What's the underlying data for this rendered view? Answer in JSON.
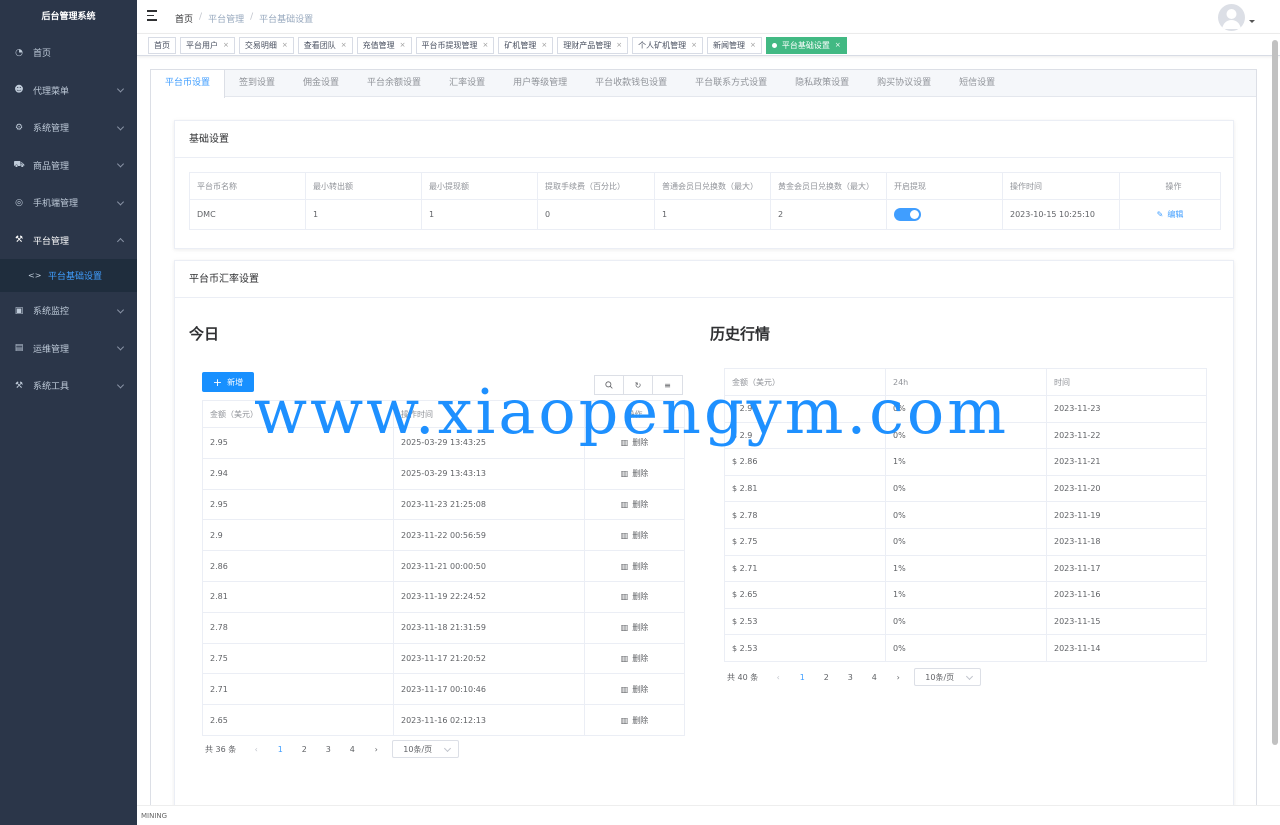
{
  "brand": "后台管理系统",
  "sidebar": {
    "items": [
      {
        "label": "首页",
        "icon": "dashboard-icon",
        "chevron": false
      },
      {
        "label": "代理菜单",
        "icon": "user-icon",
        "chevron": true
      },
      {
        "label": "系统管理",
        "icon": "gear-icon",
        "chevron": true
      },
      {
        "label": "商品管理",
        "icon": "cart-icon",
        "chevron": true
      },
      {
        "label": "手机端管理",
        "icon": "phone-icon",
        "chevron": true
      },
      {
        "label": "平台管理",
        "icon": "tools-icon",
        "chevron": true,
        "open": true
      },
      {
        "label": "系统监控",
        "icon": "monitor-icon",
        "chevron": true
      },
      {
        "label": "运维管理",
        "icon": "server-icon",
        "chevron": true
      },
      {
        "label": "系统工具",
        "icon": "wrench-icon",
        "chevron": true
      }
    ],
    "submenu_active": "平台基础设置"
  },
  "breadcrumb": [
    "首页",
    "平台管理",
    "平台基础设置"
  ],
  "tags": [
    "首页",
    "平台用户",
    "交易明细",
    "查看团队",
    "充值管理",
    "平台币提现管理",
    "矿机管理",
    "理财产品管理",
    "个人矿机管理",
    "新闻管理",
    "平台基础设置"
  ],
  "tabs": [
    "平台币设置",
    "签到设置",
    "佣金设置",
    "平台余额设置",
    "汇率设置",
    "用户等级管理",
    "平台收款钱包设置",
    "平台联系方式设置",
    "隐私政策设置",
    "购买协议设置",
    "短信设置"
  ],
  "basic": {
    "title": "基础设置",
    "headers": [
      "平台币名称",
      "最小转出额",
      "最小提现额",
      "提取手续费（百分比）",
      "普通会员日兑换数（最大）",
      "黄金会员日兑换数（最大）",
      "开启提现",
      "操作时间",
      "操作"
    ],
    "row": [
      "DMC",
      "1",
      "1",
      "0",
      "1",
      "2",
      "",
      "2023-10-15 10:25:10"
    ],
    "edit_label": "编辑",
    "withdraw_enabled": true
  },
  "rate": {
    "title": "平台币汇率设置",
    "today_title": "今日",
    "history_title": "历史行情",
    "add_label": "新增",
    "today_headers": [
      "金额（美元）",
      "操作时间",
      "操作"
    ],
    "today_rows": [
      [
        "2.95",
        "2025-03-29 13:43:25"
      ],
      [
        "2.94",
        "2025-03-29 13:43:13"
      ],
      [
        "2.95",
        "2023-11-23 21:25:08"
      ],
      [
        "2.9",
        "2023-11-22 00:56:59"
      ],
      [
        "2.86",
        "2023-11-21 00:00:50"
      ],
      [
        "2.81",
        "2023-11-19 22:24:52"
      ],
      [
        "2.78",
        "2023-11-18 21:31:59"
      ],
      [
        "2.75",
        "2023-11-17 21:20:52"
      ],
      [
        "2.71",
        "2023-11-17 00:10:46"
      ],
      [
        "2.65",
        "2023-11-16 02:12:13"
      ]
    ],
    "delete_label": "删除",
    "today_total": "共 36 条",
    "history_headers": [
      "金额（美元）",
      "24h",
      "时间"
    ],
    "history_rows": [
      [
        "$ 2.9",
        "0%",
        "2023-11-23"
      ],
      [
        "$ 2.9",
        "0%",
        "2023-11-22"
      ],
      [
        "$ 2.86",
        "1%",
        "2023-11-21"
      ],
      [
        "$ 2.81",
        "0%",
        "2023-11-20"
      ],
      [
        "$ 2.78",
        "0%",
        "2023-11-19"
      ],
      [
        "$ 2.75",
        "0%",
        "2023-11-18"
      ],
      [
        "$ 2.71",
        "1%",
        "2023-11-17"
      ],
      [
        "$ 2.65",
        "1%",
        "2023-11-16"
      ],
      [
        "$ 2.53",
        "0%",
        "2023-11-15"
      ],
      [
        "$ 2.53",
        "0%",
        "2023-11-14"
      ]
    ],
    "history_total": "共 40 条",
    "pages": [
      "1",
      "2",
      "3",
      "4"
    ],
    "page_size": "10条/页"
  },
  "watermark": "www.xiaopengym.com",
  "footer": "MINING",
  "colors": {
    "sidebar_bg": "#2b3649",
    "primary": "#409eff",
    "active_tag": "#42b983",
    "danger": "#f56c6c",
    "add_button": "#1890ff"
  }
}
